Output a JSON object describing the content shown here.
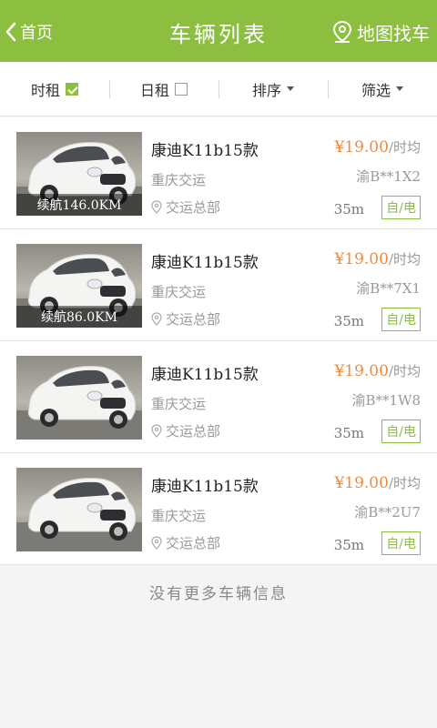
{
  "header": {
    "back_label": "首页",
    "title": "车辆列表",
    "map_label": "地图找车"
  },
  "filters": {
    "hourly": {
      "label": "时租",
      "checked": true
    },
    "daily": {
      "label": "日租",
      "checked": false
    },
    "sort": {
      "label": "排序"
    },
    "filter": {
      "label": "筛选"
    }
  },
  "cars": [
    {
      "name": "康迪K11b15款",
      "company": "重庆交运",
      "location": "交运总部",
      "price": "¥19.00",
      "price_unit": "/时均",
      "plate": "渝B**1X2",
      "distance": "35m",
      "type": "自/电",
      "range": "续航146.0KM"
    },
    {
      "name": "康迪K11b15款",
      "company": "重庆交运",
      "location": "交运总部",
      "price": "¥19.00",
      "price_unit": "/时均",
      "plate": "渝B**7X1",
      "distance": "35m",
      "type": "自/电",
      "range": "续航86.0KM"
    },
    {
      "name": "康迪K11b15款",
      "company": "重庆交运",
      "location": "交运总部",
      "price": "¥19.00",
      "price_unit": "/时均",
      "plate": "渝B**1W8",
      "distance": "35m",
      "type": "自/电",
      "range": ""
    },
    {
      "name": "康迪K11b15款",
      "company": "重庆交运",
      "location": "交运总部",
      "price": "¥19.00",
      "price_unit": "/时均",
      "plate": "渝B**2U7",
      "distance": "35m",
      "type": "自/电",
      "range": ""
    }
  ],
  "footer_text": "没有更多车辆信息",
  "colors": {
    "brand_green": "#8cbf3f",
    "price_orange": "#f08a3c"
  }
}
